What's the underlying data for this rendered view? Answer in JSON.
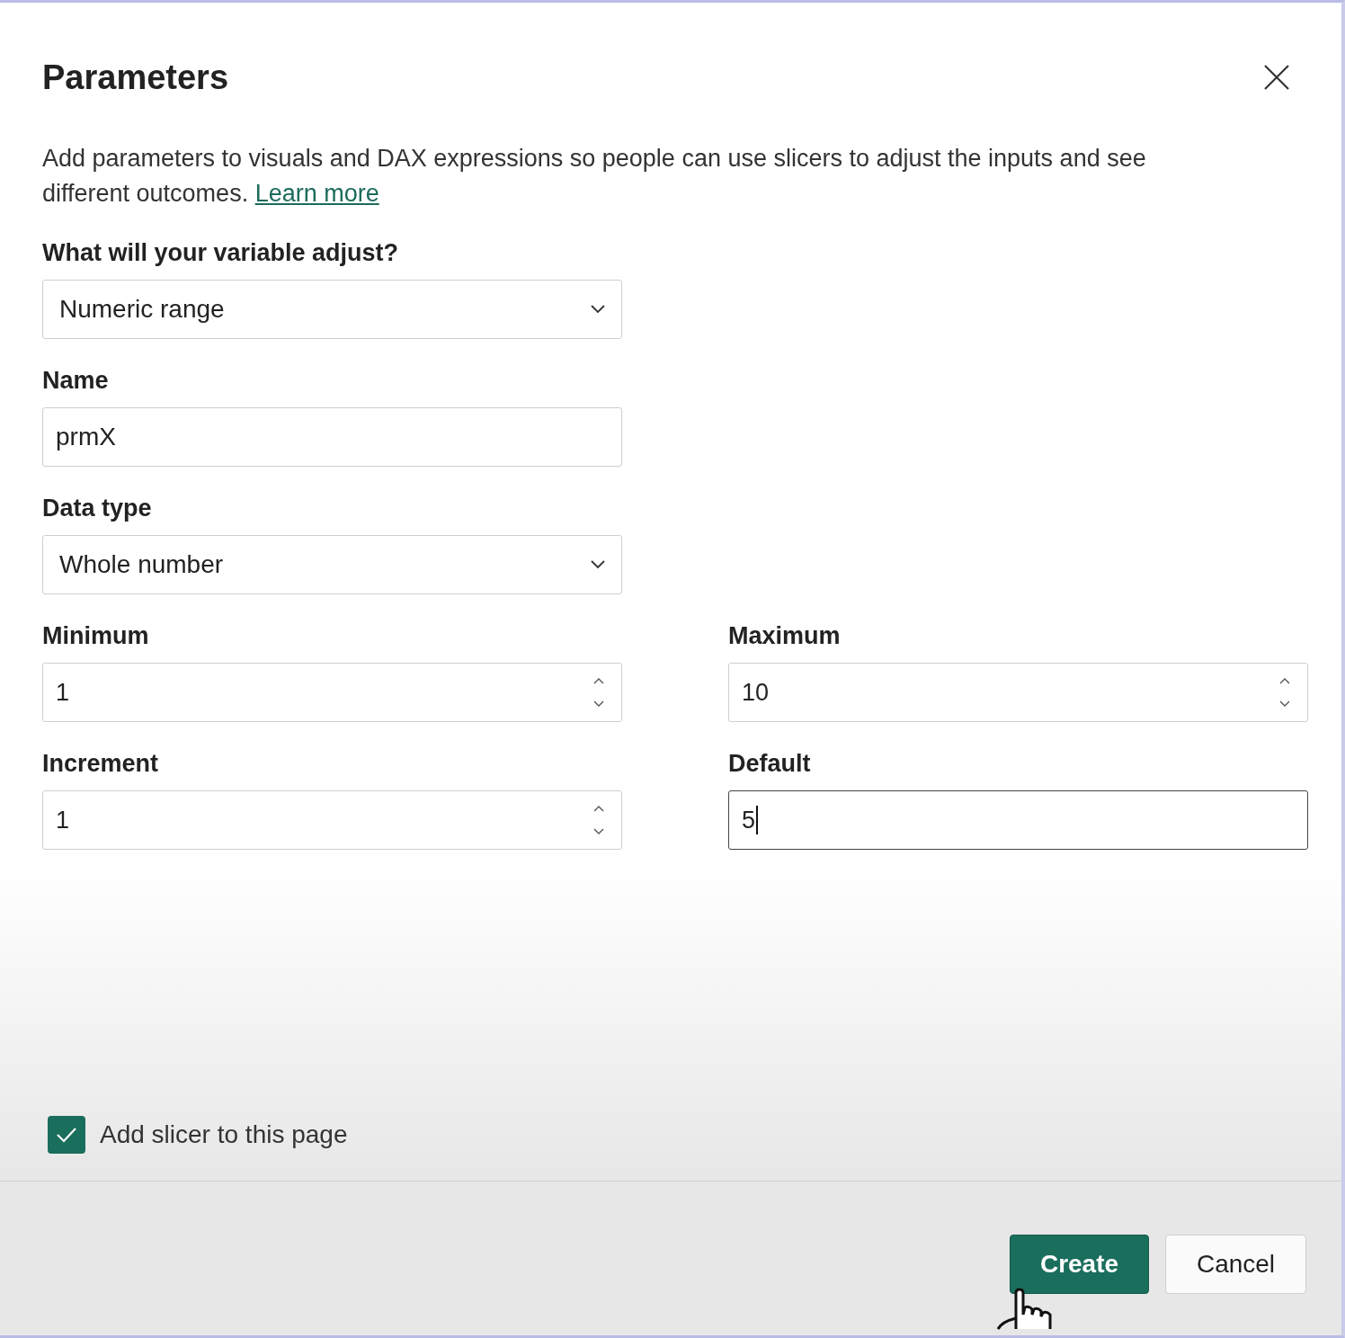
{
  "dialog": {
    "title": "Parameters",
    "description": "Add parameters to visuals and DAX expressions so people can use slicers to adjust the inputs and see different outcomes.",
    "learn_more": "Learn more"
  },
  "fields": [
    {
      "kind": "dropdown",
      "label": "What will your variable adjust?",
      "value": "Numeric range"
    },
    {
      "kind": "text",
      "label": "Name",
      "value": "prmX"
    },
    {
      "kind": "dropdown",
      "label": "Data type",
      "value": "Whole number"
    }
  ],
  "range_fields": [
    {
      "kind": "spin",
      "label": "Minimum",
      "value": "1",
      "focused": false
    },
    {
      "kind": "spin",
      "label": "Maximum",
      "value": "10",
      "focused": false
    },
    {
      "kind": "spin",
      "label": "Increment",
      "value": "1",
      "focused": false
    },
    {
      "kind": "text",
      "label": "Default",
      "value": "5",
      "focused": true
    }
  ],
  "slicer_option": {
    "label": "Add slicer to this page",
    "checked": true
  },
  "buttons": [
    {
      "kind": "primary",
      "label": "Create"
    },
    {
      "kind": "secondary",
      "label": "Cancel"
    }
  ]
}
